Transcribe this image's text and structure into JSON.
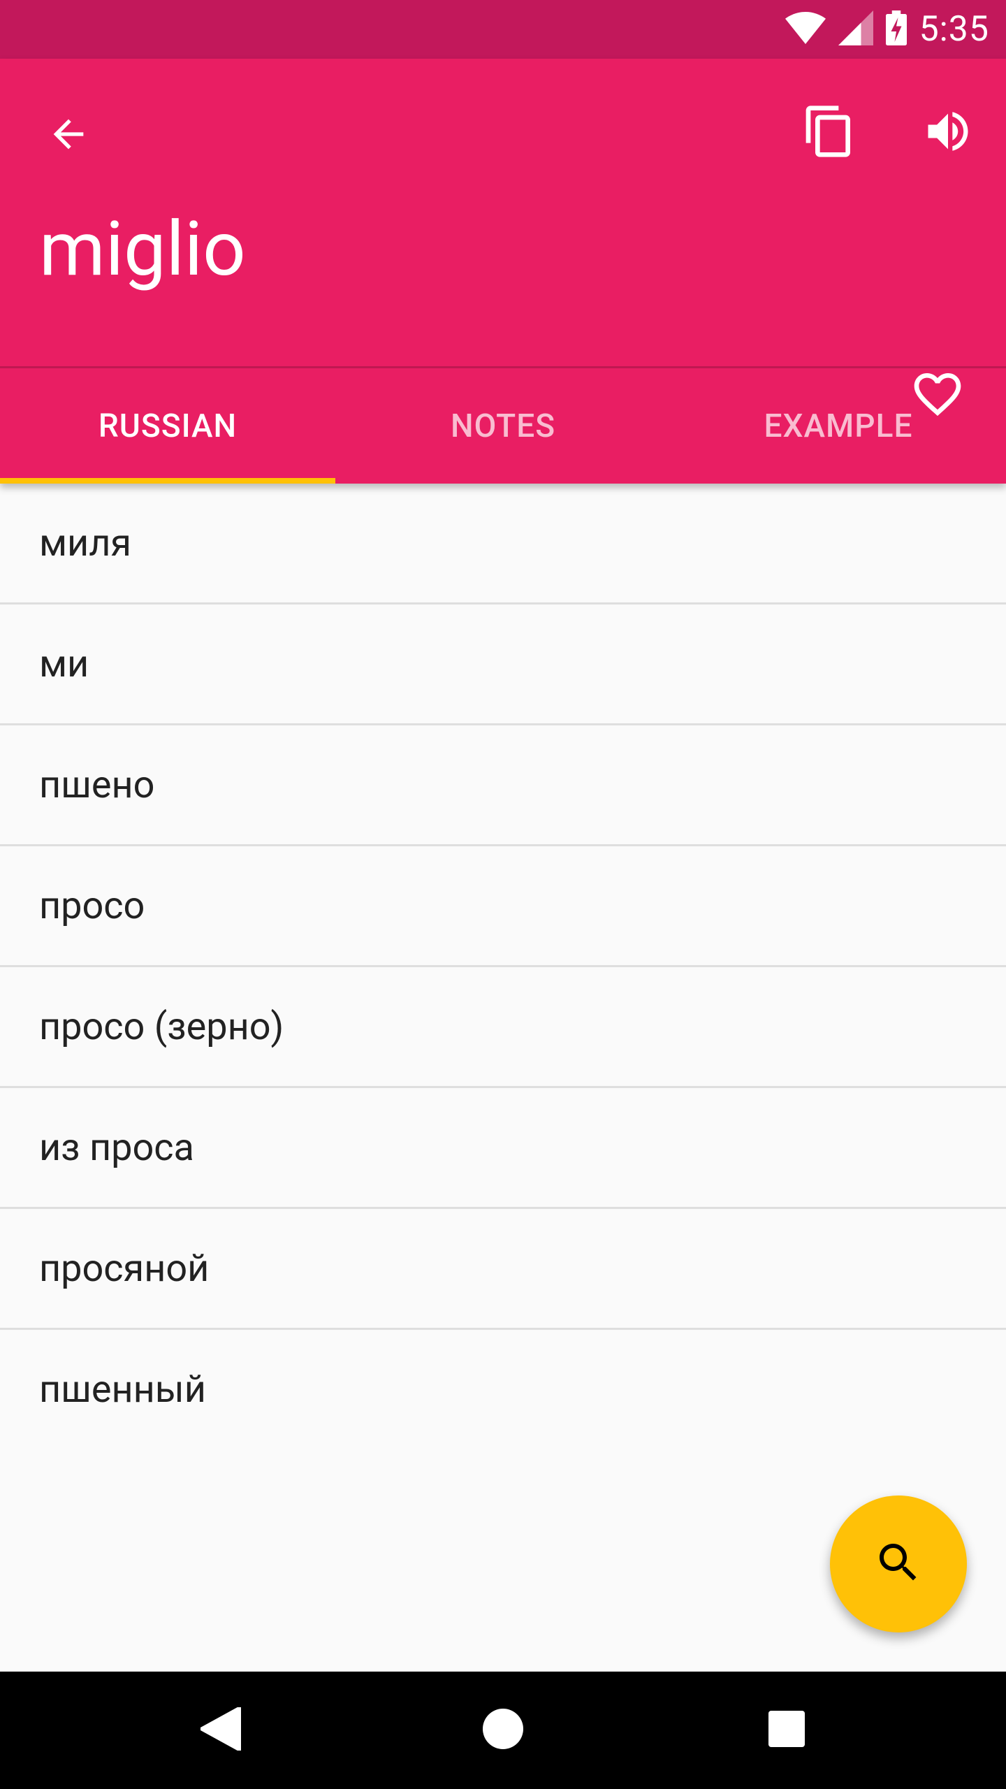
{
  "status_bar": {
    "time": "5:35",
    "icons": [
      "wifi-icon",
      "signal-icon",
      "battery-charging-icon"
    ]
  },
  "app_bar": {
    "title": "miglio",
    "back_icon": "arrow-back-icon",
    "copy_icon": "copy-icon",
    "sound_icon": "volume-icon",
    "favorite_icon": "heart-outline-icon",
    "background_color": "#e91e63",
    "status_bar_color": "#c2185b"
  },
  "tabs": [
    {
      "label": "RUSSIAN",
      "active": true
    },
    {
      "label": "NOTES",
      "active": false
    },
    {
      "label": "EXAMPLE",
      "active": false
    }
  ],
  "translations": [
    "миля",
    "ми",
    "пшено",
    "просо",
    "просо (зерно)",
    "из проса",
    "просяной",
    "пшенный"
  ],
  "fab": {
    "icon": "search-icon",
    "color": "#ffc107"
  },
  "nav_bar": {
    "buttons": [
      "back-triangle-icon",
      "home-circle-icon",
      "recents-square-icon"
    ]
  }
}
